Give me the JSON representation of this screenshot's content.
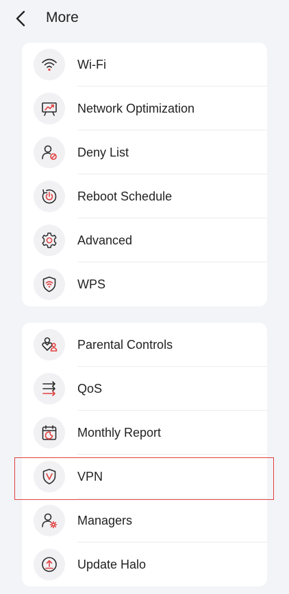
{
  "header": {
    "title": "More",
    "back_icon": "chevron-left-icon"
  },
  "colors": {
    "accent": "#e0403e",
    "icon_stroke": "#2b2b2b",
    "background": "#f3f4f8",
    "card": "#ffffff"
  },
  "group1": {
    "items": [
      {
        "label": "Wi-Fi",
        "icon": "wifi-icon"
      },
      {
        "label": "Network Optimization",
        "icon": "network-optimization-icon"
      },
      {
        "label": "Deny List",
        "icon": "deny-list-icon"
      },
      {
        "label": "Reboot Schedule",
        "icon": "reboot-schedule-icon"
      },
      {
        "label": "Advanced",
        "icon": "advanced-gear-icon"
      },
      {
        "label": "WPS",
        "icon": "wps-shield-icon"
      }
    ]
  },
  "group2": {
    "items": [
      {
        "label": "Parental Controls",
        "icon": "parental-controls-icon"
      },
      {
        "label": "QoS",
        "icon": "qos-icon"
      },
      {
        "label": "Monthly Report",
        "icon": "monthly-report-icon"
      },
      {
        "label": "VPN",
        "icon": "vpn-shield-icon"
      },
      {
        "label": "Managers",
        "icon": "managers-icon"
      },
      {
        "label": "Update Halo",
        "icon": "update-icon"
      }
    ]
  }
}
